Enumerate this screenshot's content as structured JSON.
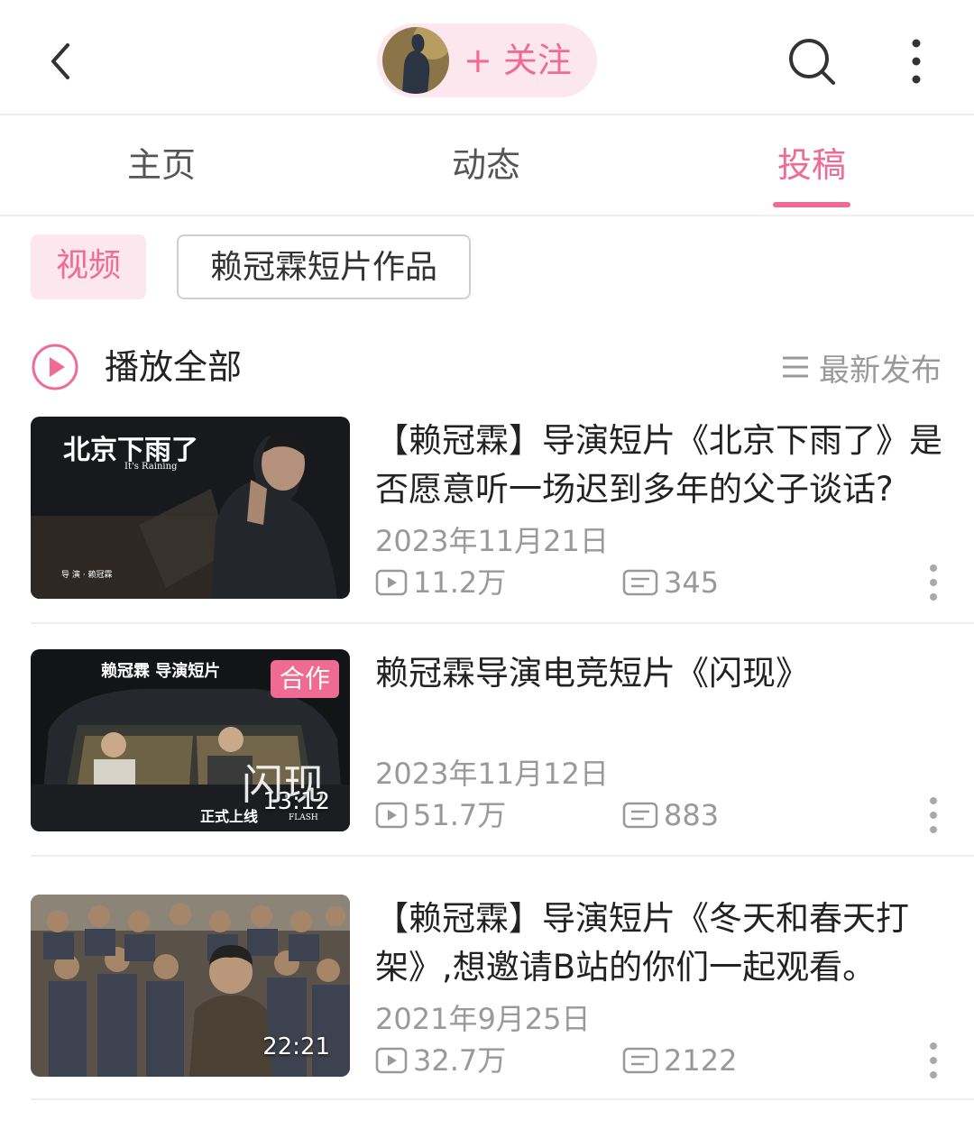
{
  "header": {
    "follow_label": "+ 关注",
    "icons": {
      "back": "chevron-left-icon",
      "search": "search-icon",
      "more": "more-vertical-icon"
    }
  },
  "tabs": [
    {
      "label": "主页",
      "active": false
    },
    {
      "label": "动态",
      "active": false
    },
    {
      "label": "投稿",
      "active": true
    }
  ],
  "filters": {
    "chips": [
      {
        "label": "视频",
        "active": true
      },
      {
        "label": "赖冠霖短片作品",
        "active": false
      }
    ]
  },
  "list_header": {
    "play_all_label": "播放全部",
    "sort_label": "最新发布"
  },
  "videos": [
    {
      "title": "【赖冠霖】导演短片《北京下雨了》是否愿意听一场迟到多年的父子谈话?",
      "date": "2023年11月21日",
      "views": "11.2万",
      "comments": "345",
      "duration": "",
      "badge": "",
      "thumb_title": "北京下雨了",
      "thumb_subtitle": "It's Raining",
      "thumb_credit": "导 演 · 赖冠霖"
    },
    {
      "title": "赖冠霖导演电竞短片《闪现》",
      "date": "2023年11月12日",
      "views": "51.7万",
      "comments": "883",
      "duration": "13:12",
      "badge": "合作",
      "thumb_title": "赖冠霖 导演短片",
      "thumb_subtitle": "FLASH",
      "thumb_credit": "正式上线",
      "thumb_mark": "闪现"
    },
    {
      "title": "【赖冠霖】导演短片《冬天和春天打架》,想邀请B站的你们一起观看。",
      "date": "2021年9月25日",
      "views": "32.7万",
      "comments": "2122",
      "duration": "22:21",
      "badge": ""
    }
  ],
  "colors": {
    "accent": "#f06b93",
    "accent_bg": "#fce7ef",
    "muted_text": "#999999"
  }
}
